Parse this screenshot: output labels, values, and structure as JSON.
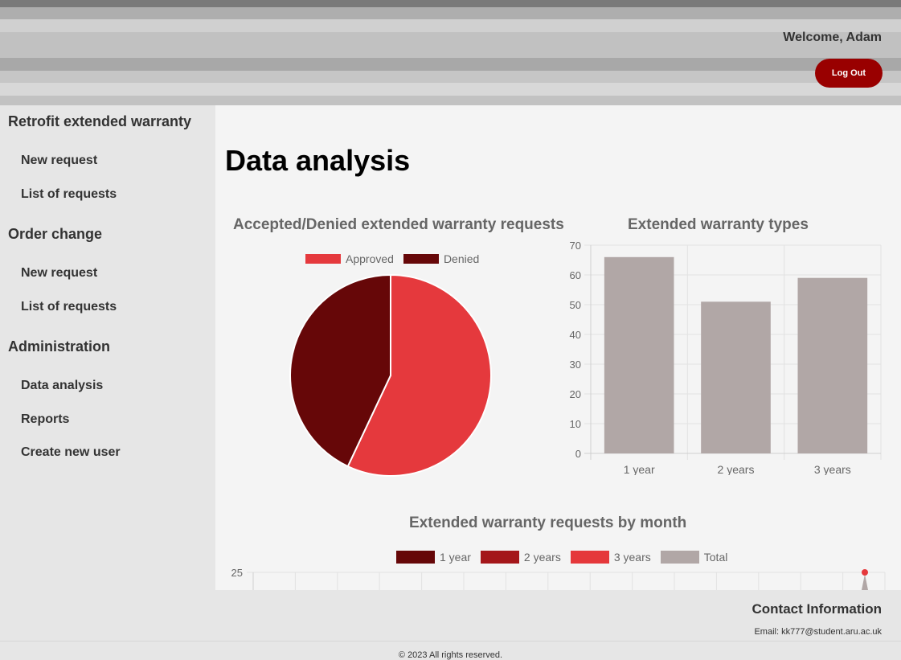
{
  "header": {
    "welcome": "Welcome, Adam",
    "logout_label": "Log Out",
    "logout_color": "#990000"
  },
  "sidebar": {
    "sections": [
      {
        "title": "Retrofit extended warranty",
        "items": [
          {
            "label": "New request"
          },
          {
            "label": "List of requests"
          }
        ]
      },
      {
        "title": "Order change",
        "items": [
          {
            "label": "New request"
          },
          {
            "label": "List of requests"
          }
        ]
      },
      {
        "title": "Administration",
        "items": [
          {
            "label": "Data analysis"
          },
          {
            "label": "Reports"
          },
          {
            "label": "Create new user"
          }
        ]
      }
    ]
  },
  "main": {
    "page_title": "Data analysis"
  },
  "charts": {
    "pie": {
      "title": "Accepted/Denied extended warranty requests",
      "legend": [
        {
          "label": "Approved",
          "color": "#e5393d"
        },
        {
          "label": "Denied",
          "color": "#660708"
        }
      ]
    },
    "bar": {
      "title": "Extended warranty types"
    },
    "month": {
      "title": "Extended warranty requests by month",
      "legend": [
        {
          "label": "1 year",
          "color": "#660708"
        },
        {
          "label": "2 years",
          "color": "#a4161a"
        },
        {
          "label": "3 years",
          "color": "#e5383b"
        },
        {
          "label": "Total",
          "color": "#b1a7a6"
        }
      ],
      "y_tick_visible": "25"
    }
  },
  "chart_data": [
    {
      "type": "pie",
      "title": "Accepted/Denied extended warranty requests",
      "labels": [
        "Approved",
        "Denied"
      ],
      "values": [
        57,
        43
      ],
      "colors": [
        "#e5393d",
        "#660708"
      ],
      "legend": "top"
    },
    {
      "type": "bar",
      "title": "Extended warranty types",
      "categories": [
        "1 year",
        "2 years",
        "3 years"
      ],
      "values": [
        66,
        51,
        59
      ],
      "ylim": [
        0,
        70
      ],
      "yticks": [
        0,
        10,
        20,
        30,
        40,
        50,
        60,
        70
      ],
      "color": "#b1a7a6",
      "grid": true
    },
    {
      "type": "line",
      "title": "Extended warranty requests by month",
      "series": [
        {
          "name": "1 year",
          "color": "#660708"
        },
        {
          "name": "2 years",
          "color": "#a4161a"
        },
        {
          "name": "3 years",
          "color": "#e5383b"
        },
        {
          "name": "Total",
          "color": "#b1a7a6"
        }
      ],
      "legend": "top",
      "grid": true
    }
  ],
  "footer": {
    "contact_title": "Contact Information",
    "email": "Email: kk777@student.aru.ac.uk",
    "copyright": "© 2023 All rights reserved."
  }
}
